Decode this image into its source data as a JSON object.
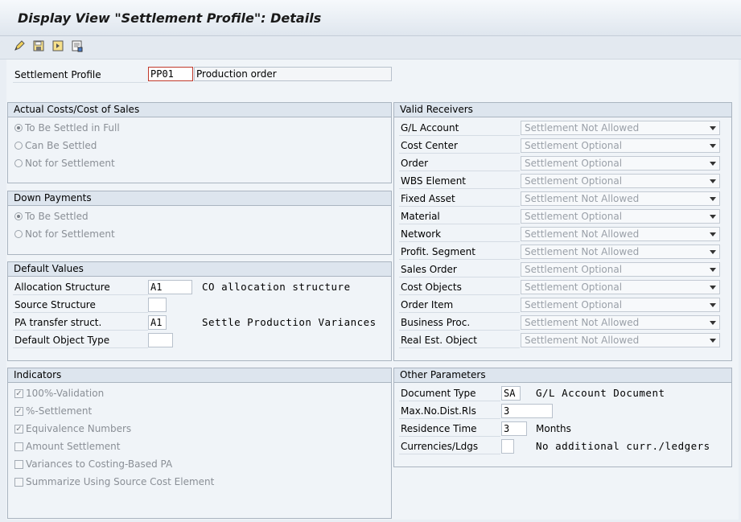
{
  "title": "Display View \"Settlement Profile\": Details",
  "toolbar": {
    "icons": [
      "edit-icon",
      "save-icon",
      "next-entry-icon",
      "other-icon"
    ]
  },
  "header": {
    "label": "Settlement Profile",
    "value": "PP01",
    "description": "Production order"
  },
  "actual_costs": {
    "title": "Actual Costs/Cost of Sales",
    "options": [
      "To Be Settled in Full",
      "Can Be Settled",
      "Not for Settlement"
    ],
    "selected": 0
  },
  "down_payments": {
    "title": "Down Payments",
    "options": [
      "To Be Settled",
      "Not for Settlement"
    ],
    "selected": 0
  },
  "default_values": {
    "title": "Default Values",
    "rows": [
      {
        "label": "Allocation Structure",
        "value": "A1",
        "text": "CO allocation structure"
      },
      {
        "label": "Source Structure",
        "value": "",
        "text": ""
      },
      {
        "label": "PA transfer struct.",
        "value": "A1",
        "text": "Settle Production Variances"
      },
      {
        "label": "Default Object Type",
        "value": "",
        "text": ""
      }
    ]
  },
  "indicators": {
    "title": "Indicators",
    "items": [
      {
        "label": "100%-Validation",
        "checked": true
      },
      {
        "label": "%-Settlement",
        "checked": true
      },
      {
        "label": "Equivalence Numbers",
        "checked": true
      },
      {
        "label": "Amount Settlement",
        "checked": false
      },
      {
        "label": "Variances to Costing-Based PA",
        "checked": false
      },
      {
        "label": "Summarize Using Source Cost Element",
        "checked": false
      }
    ]
  },
  "valid_receivers": {
    "title": "Valid Receivers",
    "rows": [
      {
        "label": "G/L Account",
        "value": "Settlement Not Allowed"
      },
      {
        "label": "Cost Center",
        "value": "Settlement Optional"
      },
      {
        "label": "Order",
        "value": "Settlement Optional"
      },
      {
        "label": "WBS Element",
        "value": "Settlement Optional"
      },
      {
        "label": "Fixed Asset",
        "value": "Settlement Not Allowed"
      },
      {
        "label": "Material",
        "value": "Settlement Optional"
      },
      {
        "label": "Network",
        "value": "Settlement Not Allowed"
      },
      {
        "label": "Profit. Segment",
        "value": "Settlement Not Allowed"
      },
      {
        "label": "Sales Order",
        "value": "Settlement Optional"
      },
      {
        "label": "Cost Objects",
        "value": "Settlement Optional"
      },
      {
        "label": "Order Item",
        "value": "Settlement Optional"
      },
      {
        "label": "Business Proc.",
        "value": "Settlement Not Allowed"
      },
      {
        "label": "Real Est. Object",
        "value": "Settlement Not Allowed"
      }
    ]
  },
  "other_parameters": {
    "title": "Other Parameters",
    "rows": [
      {
        "label": "Document Type",
        "value": "SA",
        "text": "G/L Account Document"
      },
      {
        "label": "Max.No.Dist.Rls",
        "value": "3",
        "text": ""
      },
      {
        "label": "Residence Time",
        "value": "3",
        "text": "Months"
      },
      {
        "label": "Currencies/Ldgs",
        "value": "",
        "text": "No additional curr./ledgers"
      }
    ]
  }
}
